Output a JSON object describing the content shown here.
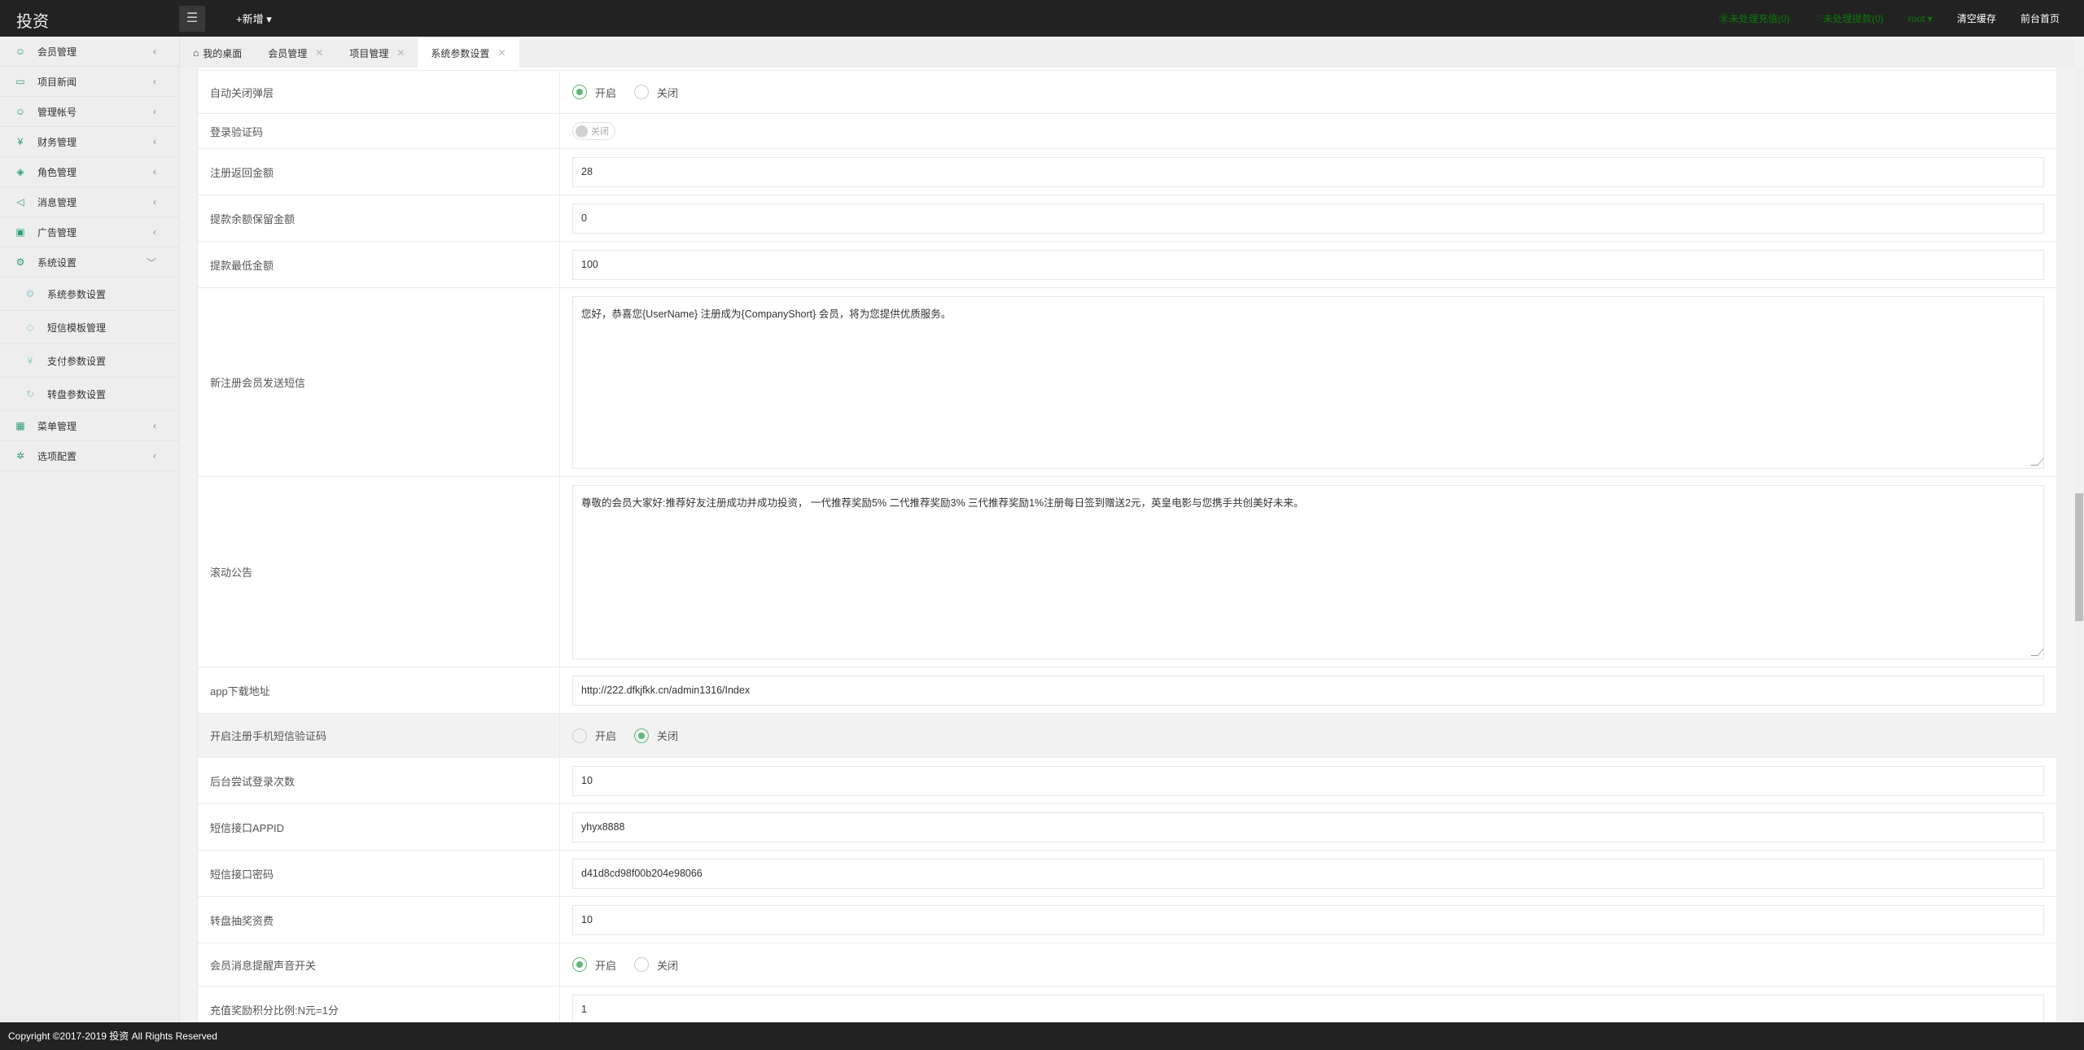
{
  "header": {
    "title": "投资",
    "add_new": "+新增 ▾",
    "pending_recharge": "㊎未处理充值(0)",
    "pending_withdraw": "♡未处理提款(0)",
    "user": "root ▾",
    "clear_cache": "清空缓存",
    "frontend_home": "前台首页"
  },
  "sidebar": {
    "items": [
      {
        "label": "会员管理",
        "icon": "user-icon",
        "glyph": "☺",
        "expanded": false
      },
      {
        "label": "项目新闻",
        "icon": "book-icon",
        "glyph": "▭",
        "expanded": false
      },
      {
        "label": "管理帐号",
        "icon": "users-icon",
        "glyph": "☺",
        "expanded": false
      },
      {
        "label": "财务管理",
        "icon": "yen-icon",
        "glyph": "¥",
        "expanded": false
      },
      {
        "label": "角色管理",
        "icon": "shield-icon",
        "glyph": "◈",
        "expanded": false
      },
      {
        "label": "消息管理",
        "icon": "speaker-icon",
        "glyph": "◁",
        "expanded": false
      },
      {
        "label": "广告管理",
        "icon": "image-icon",
        "glyph": "▣",
        "expanded": false
      },
      {
        "label": "系统设置",
        "icon": "gear-icon",
        "glyph": "⚙",
        "expanded": true
      }
    ],
    "subitems": [
      {
        "label": "系统参数设置",
        "icon": "gear-icon",
        "glyph": "⚙"
      },
      {
        "label": "短信模板管理",
        "icon": "tag-icon",
        "glyph": "◇"
      },
      {
        "label": "支付参数设置",
        "icon": "yen-icon",
        "glyph": "¥"
      },
      {
        "label": "转盘参数设置",
        "icon": "refresh-icon",
        "glyph": "↻"
      }
    ],
    "items2": [
      {
        "label": "菜单管理",
        "icon": "grid-icon",
        "glyph": "▦"
      },
      {
        "label": "选项配置",
        "icon": "config-icon",
        "glyph": "✲"
      }
    ]
  },
  "tabs": [
    {
      "label": "我的桌面"
    },
    {
      "label": "会员管理"
    },
    {
      "label": "项目管理"
    },
    {
      "label": "系统参数设置"
    }
  ],
  "form": {
    "auto_close": {
      "label": "自动关闭弹层",
      "on": "开启",
      "off": "关闭",
      "selected": "on"
    },
    "login_captcha": {
      "label": "登录验证码",
      "value": "关闭"
    },
    "register_bonus": {
      "label": "注册返回金额",
      "value": "28"
    },
    "withdraw_reserve": {
      "label": "提款余额保留金额",
      "value": "0"
    },
    "withdraw_min": {
      "label": "提款最低金额",
      "value": "100"
    },
    "register_sms": {
      "label": "新注册会员发送短信",
      "value": "您好，恭喜您{UserName} 注册成为{CompanyShort} 会员，将为您提供优质服务。"
    },
    "notice": {
      "label": "滚动公告",
      "value": "尊敬的会员大家好:推荐好友注册成功并成功投资，  一代推荐奖励5%  二代推荐奖励3%  三代推荐奖励1%注册每日签到赠送2元，英皇电影与您携手共创美好未来。"
    },
    "app_url": {
      "label": "app下载地址",
      "value": "http://222.dfkjfkk.cn/admin1316/Index"
    },
    "sms_verify": {
      "label": "开启注册手机短信验证码",
      "on": "开启",
      "off": "关闭",
      "selected": "off"
    },
    "login_attempts": {
      "label": "后台尝试登录次数",
      "value": "10"
    },
    "sms_appid": {
      "label": "短信接口APPID",
      "value": "yhyx8888"
    },
    "sms_password": {
      "label": "短信接口密码",
      "value": "d41d8cd98f00b204e98066"
    },
    "wheel_fee": {
      "label": "转盘抽奖资费",
      "value": "10"
    },
    "msg_sound": {
      "label": "会员消息提醒声音开关",
      "on": "开启",
      "off": "关闭",
      "selected": "on"
    },
    "points_ratio": {
      "label": "充值奖励积分比例:N元=1分",
      "value": "1"
    }
  },
  "footer": {
    "copyright": "Copyright ©2017-2019 投资 All Rights Reserved"
  }
}
